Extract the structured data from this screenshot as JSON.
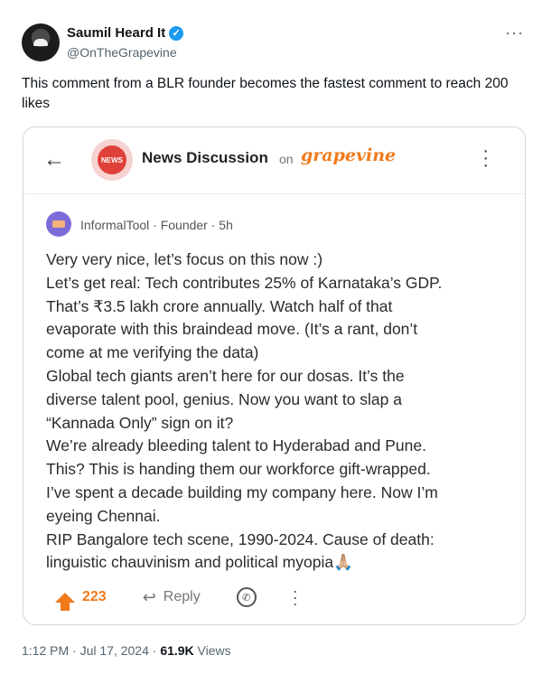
{
  "tweet": {
    "author_name": "Saumil Heard It",
    "handle": "@OnTheGrapevine",
    "text": "This comment from a BLR founder becomes the fastest comment to reach 200 likes",
    "time": "1:12 PM · Jul 17, 2024 · ",
    "views_count": "61.9K",
    "views_label": " Views",
    "more_icon": "more-horizontal-icon"
  },
  "card": {
    "logo_text": "NEWS",
    "title": "News Discussion",
    "on_label": "on",
    "brand": "grapevine",
    "comment": {
      "author": "InformalTool · Founder · 5h",
      "lines": [
        "Very very nice, let’s focus on this now :)",
        "Let’s get real: Tech contributes 25% of Karnataka’s GDP.",
        "That’s ₹3.5 lakh crore annually. Watch half of that",
        "evaporate with this braindead move. (It’s a rant, don’t",
        "come at me verifying the data)",
        "Global tech giants aren’t here for our dosas. It’s the",
        "diverse talent pool, genius. Now you want to slap a",
        "“Kannada Only” sign on it?",
        "We’re already bleeding talent to Hyderabad and Pune.",
        "This? This is handing them our workforce gift-wrapped.",
        "I’ve spent a decade building my company here. Now I’m",
        "eyeing Chennai.",
        "RIP Bangalore tech scene, 1990-2024. Cause of death:",
        "linguistic chauvinism and political myopia🙏🏼"
      ],
      "upvotes": "223",
      "reply_label": "Reply"
    }
  },
  "colors": {
    "accent": "#f07a1a",
    "verified": "#1d9bf0",
    "muted": "#536471"
  }
}
